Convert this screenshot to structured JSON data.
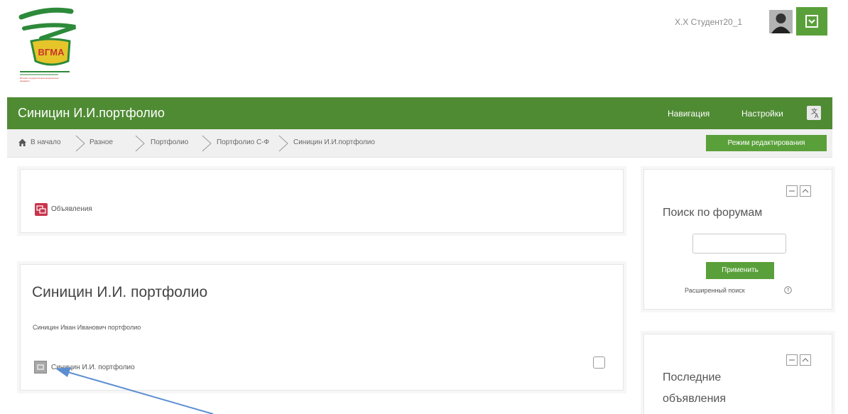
{
  "header": {
    "logo_text": "ВГМА",
    "logo_caption": "Вятская государственная медицинская академия",
    "user_name": "Х.Х Студент20_1",
    "user_menu_icon": "user-menu-icon"
  },
  "topbar": {
    "course_title": "Синицин И.И.портфолио",
    "navigation": "Навигация",
    "settings": "Настройки",
    "lang_icon": "language-icon"
  },
  "breadcrumb": {
    "items": [
      "В начало",
      "Разное",
      "Портфолио",
      "Портфолио С-Ф",
      "Синицин И.И.портфолио"
    ],
    "edit_mode": "Режим редактирования"
  },
  "main": {
    "announcements_label": "Объявления",
    "section_title": "Синицин И.И. портфолио",
    "section_summary": "Синицин Иван Иванович портфолио",
    "activity_label": "Синицин И.И. портфолио"
  },
  "sidebar": {
    "search_block": {
      "title": "Поиск по форумам",
      "apply": "Применить",
      "advanced": "Расширенный поиск"
    },
    "news_block": {
      "title_line1": "Последние",
      "title_line2": "объявления"
    }
  },
  "colors": {
    "brand_green": "#4f8b33",
    "button_green": "#5aa03a",
    "forum_red": "#c8344b",
    "arrow_blue": "#5b8ed1"
  }
}
